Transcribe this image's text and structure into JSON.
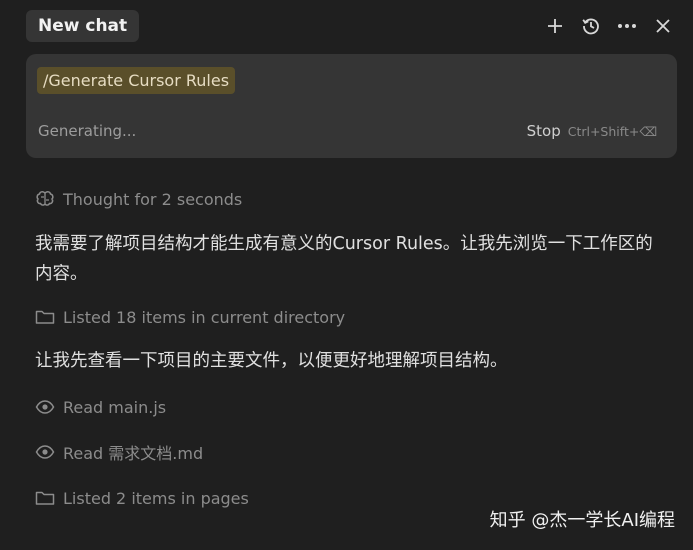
{
  "header": {
    "tab_label": "New chat",
    "icons": [
      "plus-icon",
      "history-icon",
      "more-icon",
      "close-icon"
    ]
  },
  "composer": {
    "prompt_chip": "/Generate Cursor Rules",
    "status": "Generating...",
    "stop_label": "Stop",
    "stop_shortcut": "Ctrl+Shift+⌫"
  },
  "log": {
    "thought": "Thought for 2 seconds",
    "message1": "我需要了解项目结构才能生成有意义的Cursor Rules。让我先浏览一下工作区的内容。",
    "listed1": "Listed 18 items in current directory",
    "message2": "让我先查看一下项目的主要文件，以便更好地理解项目结构。",
    "read1": "Read main.js",
    "read2": "Read 需求文档.md",
    "listed2": "Listed 2 items in pages"
  },
  "watermark": "知乎 @杰一学长AI编程",
  "colors": {
    "background": "#1f1f1f",
    "card": "#353535",
    "chip": "#5a4f2a",
    "muted_text": "#8c8c8c"
  }
}
